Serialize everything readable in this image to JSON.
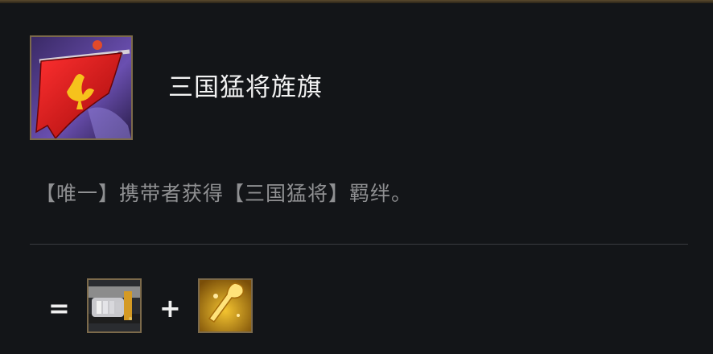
{
  "item": {
    "name": "三国猛将旌旗",
    "description": "【唯一】携带者获得【三国猛将】羁绊。",
    "icon": "red-war-banner-icon"
  },
  "recipe": {
    "equals_symbol": "=",
    "plus_symbol": "+",
    "components": [
      {
        "icon": "gauntlet-glove-icon"
      },
      {
        "icon": "golden-spatula-icon"
      }
    ]
  },
  "colors": {
    "background": "#131518",
    "frame_gold": "#7c6a4b",
    "title_text": "#f2f2f2",
    "description_text": "#8f9092"
  }
}
